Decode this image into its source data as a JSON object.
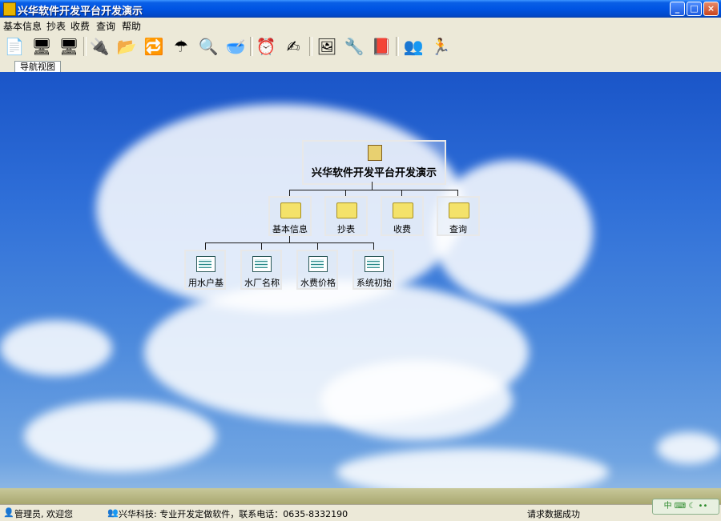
{
  "window": {
    "title": "兴华软件开发平台开发演示",
    "min": "_",
    "max": "□",
    "close": "×"
  },
  "menu": [
    "基本信息",
    "抄表",
    "收费",
    "查询",
    "帮助"
  ],
  "toolbar": [
    {
      "icon": "new-doc-icon",
      "glyph": "📄"
    },
    {
      "icon": "monitor-icon",
      "glyph": "🖥"
    },
    {
      "icon": "screen-icon",
      "glyph": "🖥"
    },
    {
      "icon": "connect-icon",
      "glyph": "🔌"
    },
    {
      "icon": "folder-doc-icon",
      "glyph": "📂"
    },
    {
      "icon": "transfer-icon",
      "glyph": "🔁"
    },
    {
      "icon": "umbrella-icon",
      "glyph": "☂"
    },
    {
      "icon": "zoom-icon",
      "glyph": "🔍"
    },
    {
      "icon": "dish-icon",
      "glyph": "🥣"
    },
    {
      "icon": "alarm-clock-icon",
      "glyph": "⏰"
    },
    {
      "icon": "edit-icon",
      "glyph": "✍"
    },
    {
      "icon": "picture-icon",
      "glyph": "🖼"
    },
    {
      "icon": "tools-icon",
      "glyph": "🔧"
    },
    {
      "icon": "help-book-icon",
      "glyph": "📕"
    },
    {
      "icon": "users-icon",
      "glyph": "👥"
    },
    {
      "icon": "exit-run-icon",
      "glyph": "🏃"
    }
  ],
  "tab": {
    "label": "导航视图"
  },
  "tree": {
    "root": "兴华软件开发平台开发演示",
    "folders": [
      "基本信息",
      "抄表",
      "收费",
      "查询"
    ],
    "forms": [
      "用水户基",
      "水厂名称",
      "水费价格",
      "系统初始"
    ]
  },
  "status": {
    "user": "管理员, 欢迎您",
    "company": "兴华科技: 专业开发定做软件，联系电话：0635-8332190",
    "message": "请求数据成功",
    "ime": "中 ⌨ ☾ ••"
  }
}
